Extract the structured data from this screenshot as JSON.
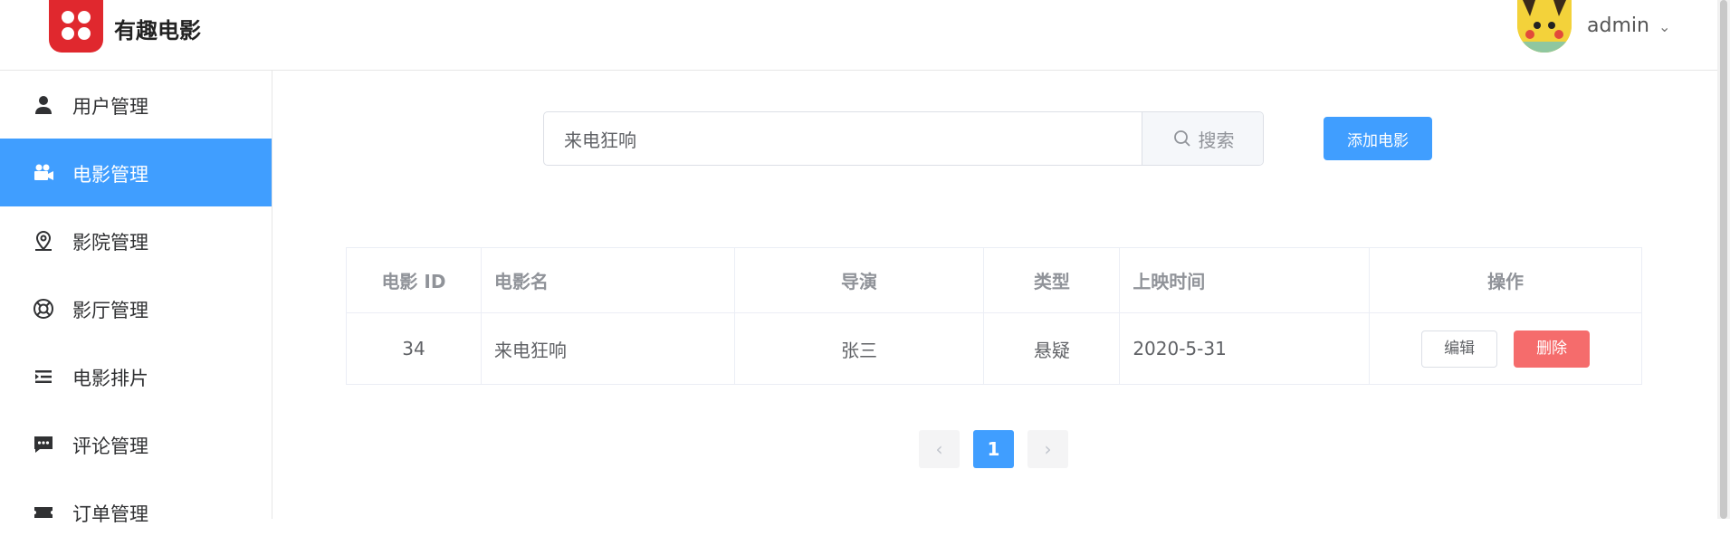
{
  "header": {
    "brand": "有趣电影",
    "user": "admin"
  },
  "sidebar": {
    "items": [
      {
        "label": "用户管理",
        "icon": "user-icon"
      },
      {
        "label": "电影管理",
        "icon": "movie-camera-icon",
        "active": true
      },
      {
        "label": "影院管理",
        "icon": "location-icon"
      },
      {
        "label": "影厅管理",
        "icon": "lifebuoy-icon"
      },
      {
        "label": "电影排片",
        "icon": "list-indent-icon"
      },
      {
        "label": "评论管理",
        "icon": "comment-icon"
      },
      {
        "label": "订单管理",
        "icon": "ticket-icon"
      }
    ]
  },
  "search": {
    "value": "来电狂响",
    "button_label": "搜索"
  },
  "toolbar": {
    "add_label": "添加电影"
  },
  "table": {
    "headers": [
      "电影 ID",
      "电影名",
      "导演",
      "类型",
      "上映时间",
      "操作"
    ],
    "rows": [
      {
        "id": "34",
        "name": "来电狂响",
        "director": "张三",
        "genre": "悬疑",
        "date": "2020-5-31"
      }
    ],
    "edit_label": "编辑",
    "delete_label": "删除"
  },
  "pagination": {
    "current": "1",
    "prev": "‹",
    "next": "›"
  },
  "colors": {
    "primary": "#409eff",
    "danger": "#f56c6c",
    "brand": "#e0282e"
  }
}
